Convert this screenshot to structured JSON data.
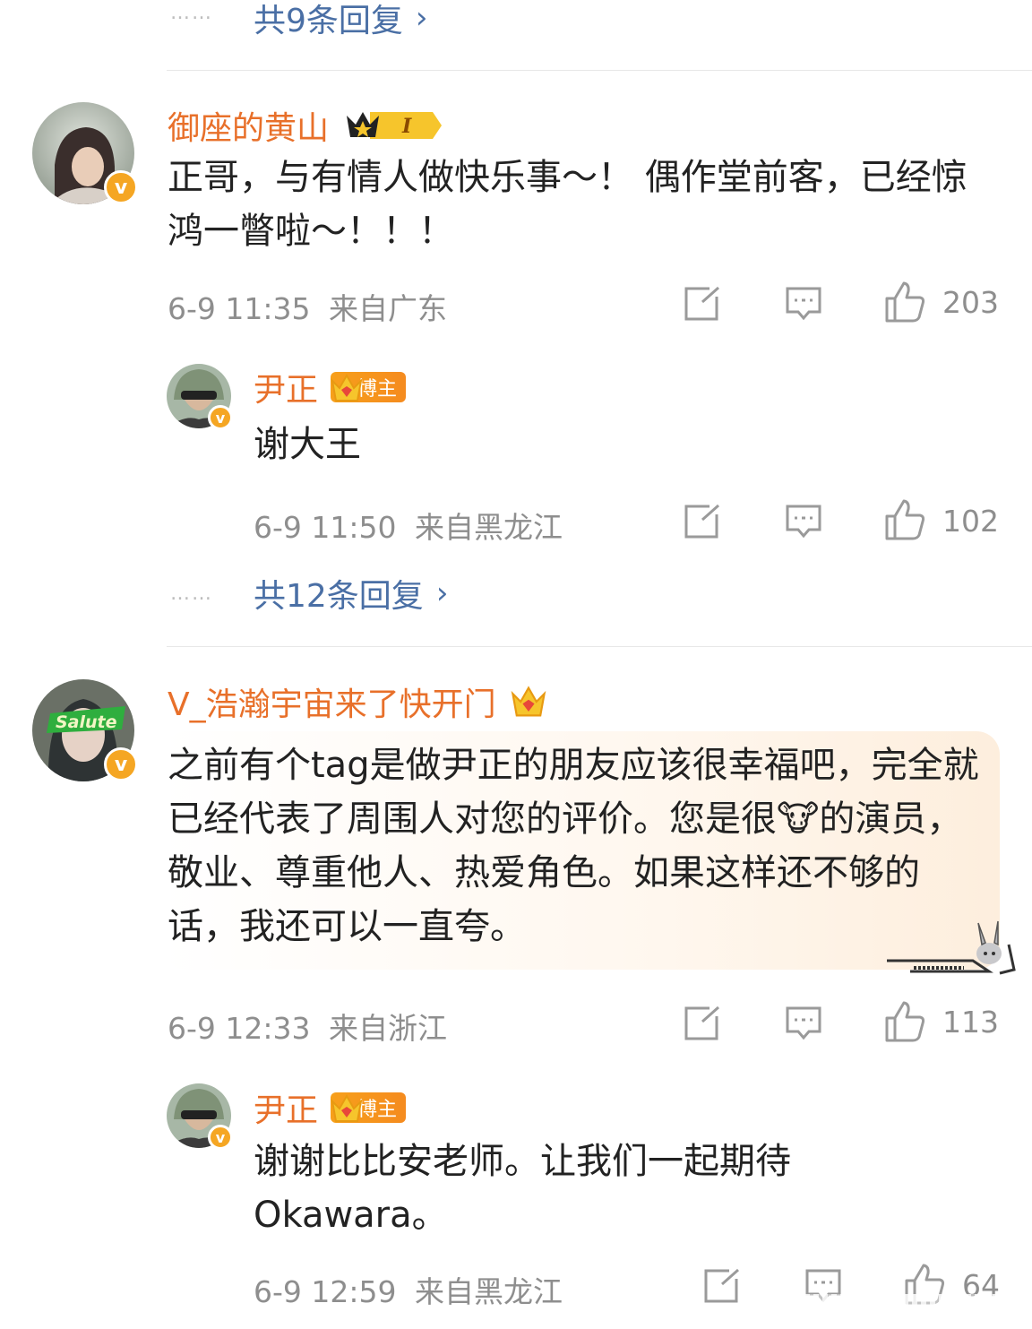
{
  "top_thread": {
    "dots": "……",
    "more_replies": "共9条回复"
  },
  "comments": [
    {
      "username": "御座的黄山",
      "level_badge": "I",
      "text": "正哥，与有情人做快乐事～！ 偶作堂前客，已经惊鸿一瞥啦～！！！",
      "time": "6-9 11:35",
      "location": "来自广东",
      "likes": "203",
      "reply": {
        "username": "尹正",
        "badge": "博主",
        "text": "谢大王",
        "time": "6-9 11:50",
        "location": "来自黑龙江",
        "likes": "102"
      },
      "dots": "……",
      "more_replies": "共12条回复"
    },
    {
      "username": "V_浩瀚宇宙来了快开门",
      "avatar_text": "Salute",
      "text": "之前有个tag是做尹正的朋友应该很幸福吧，完全就已经代表了周围人对您的评价。您是很🐮的演员，敬业、尊重他人、热爱角色。如果这样还不够的话，我还可以一直夸。",
      "time": "6-9 12:33",
      "location": "来自浙江",
      "likes": "113",
      "reply": {
        "username": "尹正",
        "badge": "博主",
        "text": "谢谢比比安老师。让我们一起期待Okawara。",
        "time": "6-9 12:59",
        "location": "来自黑龙江",
        "likes": "64"
      }
    }
  ],
  "icons": {
    "share": "share-icon",
    "comment": "comment-icon",
    "like": "like-icon",
    "verified": "v"
  },
  "colors": {
    "username": "#e8702a",
    "link": "#4a6fa5",
    "meta": "#8e8e8e",
    "badge": "#f5a623"
  }
}
